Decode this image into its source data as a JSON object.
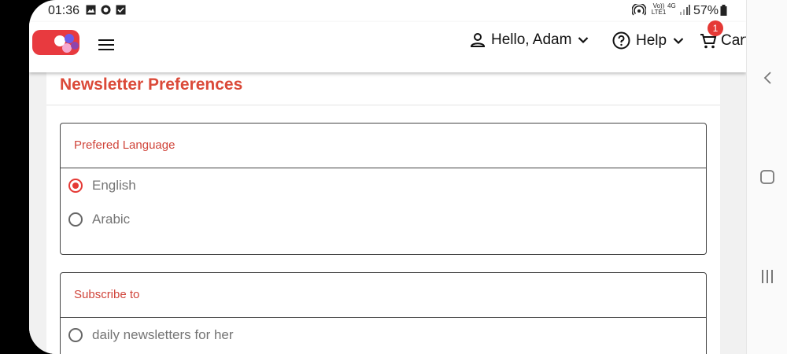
{
  "status_bar": {
    "time": "01:36",
    "left_icons": [
      "gallery-icon",
      "whatsapp-icon",
      "checkbox-icon"
    ],
    "right_icons": [
      "hotspot-icon",
      "volte-icon",
      "4g-icon",
      "signal-icon",
      "battery-icon"
    ],
    "volte_label": "Vo)) LTE1",
    "network_label": "4G",
    "battery": "57%"
  },
  "header": {
    "greeting": "Hello, Adam",
    "help_label": "Help",
    "cart_label": "Cart",
    "cart_count": "1"
  },
  "page": {
    "title": "Newsletter Preferences",
    "language_group": {
      "title": "Prefered Language",
      "options": [
        {
          "label": "English",
          "selected": true
        },
        {
          "label": "Arabic",
          "selected": false
        }
      ]
    },
    "subscribe_group": {
      "title": "Subscribe to",
      "options": [
        {
          "label": "daily newsletters for her",
          "selected": false
        }
      ]
    }
  },
  "colors": {
    "accent": "#e53935",
    "title": "#db4a39",
    "option_text": "#757575"
  }
}
